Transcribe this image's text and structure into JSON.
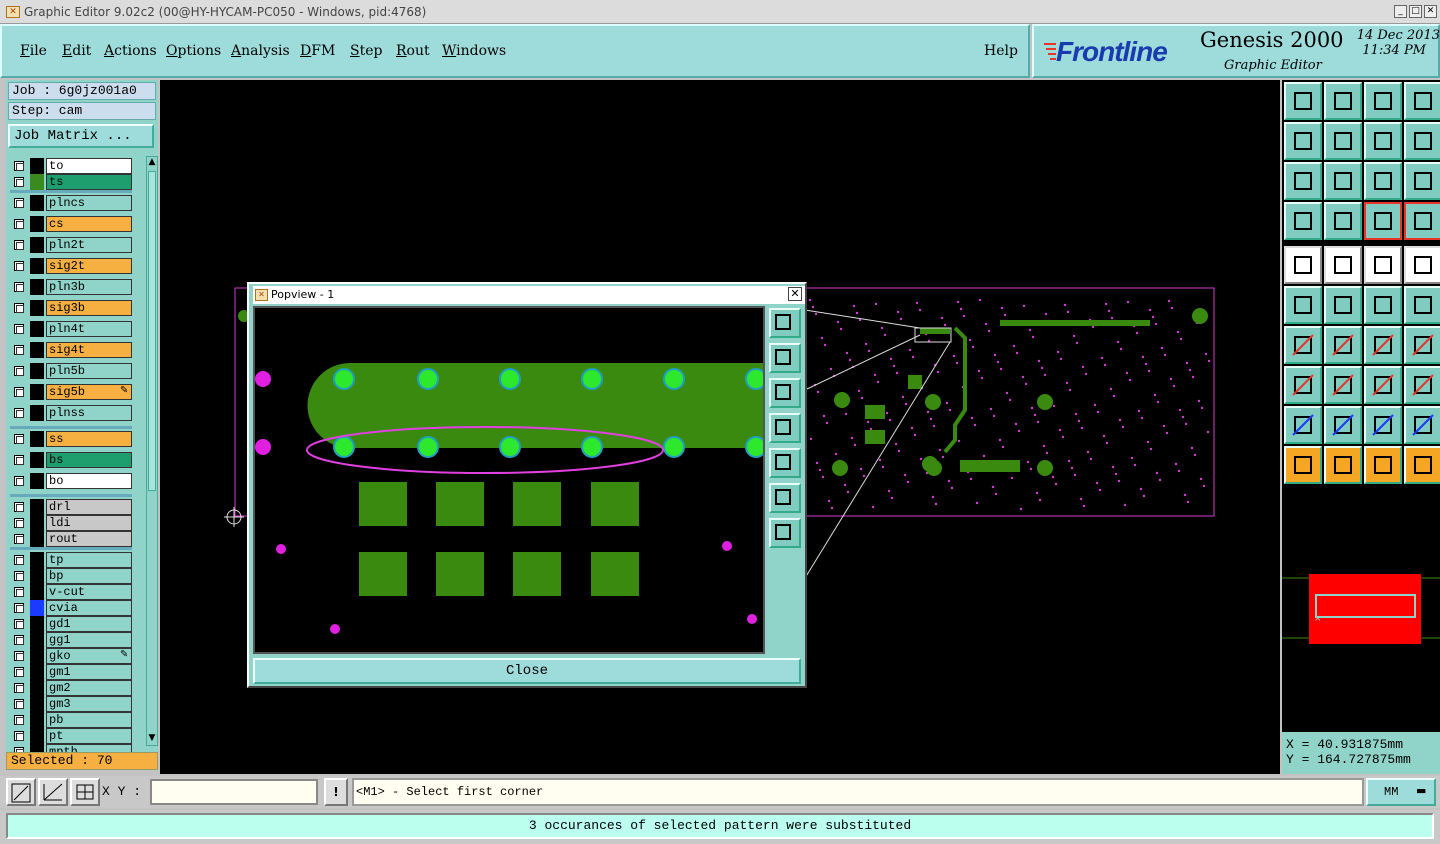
{
  "window": {
    "title": "Graphic Editor 9.02c2 (00@HY-HYCAM-PC050 - Windows, pid:4768)"
  },
  "menu": {
    "items": [
      "File",
      "Edit",
      "Actions",
      "Options",
      "Analysis",
      "DFM",
      "Step",
      "Rout",
      "Windows"
    ],
    "underline": [
      "F",
      "E",
      "A",
      "O",
      "A",
      "D",
      "S",
      "R",
      "W"
    ],
    "help": "Help"
  },
  "brand": {
    "logo": "Frontline",
    "product": "Genesis 2000",
    "subtitle": "Graphic Editor",
    "date": "14 Dec 2013",
    "time": "11:34 PM"
  },
  "job": {
    "job_line": "Job : 6g0jz001a0",
    "step_line": "Step: cam",
    "matrix_button": "Job Matrix ..."
  },
  "layers": [
    {
      "name": "to",
      "color": "#ffffff",
      "swatch": "#000000"
    },
    {
      "name": "ts",
      "color": "#1e9e6e",
      "swatch": "#3a8a20"
    },
    {
      "name": "plncs",
      "color": "#8fd3c9",
      "swatch": "#000000",
      "sepBefore": true
    },
    {
      "name": "cs",
      "color": "#f5b041",
      "swatch": "#000000"
    },
    {
      "name": "pln2t",
      "color": "#8fd3c9",
      "swatch": "#000000"
    },
    {
      "name": "sig2t",
      "color": "#f5b041",
      "swatch": "#000000"
    },
    {
      "name": "pln3b",
      "color": "#8fd3c9",
      "swatch": "#000000"
    },
    {
      "name": "sig3b",
      "color": "#f5b041",
      "swatch": "#000000"
    },
    {
      "name": "pln4t",
      "color": "#8fd3c9",
      "swatch": "#000000"
    },
    {
      "name": "sig4t",
      "color": "#f5b041",
      "swatch": "#000000"
    },
    {
      "name": "pln5b",
      "color": "#8fd3c9",
      "swatch": "#000000"
    },
    {
      "name": "sig5b",
      "color": "#f5b041",
      "swatch": "#000000",
      "mark": true
    },
    {
      "name": "plnss",
      "color": "#8fd3c9",
      "swatch": "#000000"
    },
    {
      "name": "ss",
      "color": "#f5b041",
      "swatch": "#000000",
      "sepBefore": true
    },
    {
      "name": "bs",
      "color": "#1e9e6e",
      "swatch": "#000000"
    },
    {
      "name": "bo",
      "color": "#ffffff",
      "swatch": "#000000"
    },
    {
      "name": "drl",
      "color": "#c8c8c8",
      "swatch": "#000000",
      "sepBefore": true
    },
    {
      "name": "ldi",
      "color": "#c8c8c8",
      "swatch": "#000000"
    },
    {
      "name": "rout",
      "color": "#c8c8c8",
      "swatch": "#000000"
    },
    {
      "name": "tp",
      "color": "#8fd3c9",
      "swatch": "#000000",
      "sepBefore": true
    },
    {
      "name": "bp",
      "color": "#8fd3c9",
      "swatch": "#000000"
    },
    {
      "name": "v-cut",
      "color": "#8fd3c9",
      "swatch": "#000000"
    },
    {
      "name": "cvia",
      "color": "#8fd3c9",
      "swatch": "#1a3bff"
    },
    {
      "name": "gd1",
      "color": "#8fd3c9",
      "swatch": "#000000"
    },
    {
      "name": "gg1",
      "color": "#8fd3c9",
      "swatch": "#000000"
    },
    {
      "name": "gko",
      "color": "#8fd3c9",
      "swatch": "#000000",
      "mark": true
    },
    {
      "name": "gm1",
      "color": "#8fd3c9",
      "swatch": "#000000"
    },
    {
      "name": "gm2",
      "color": "#8fd3c9",
      "swatch": "#000000"
    },
    {
      "name": "gm3",
      "color": "#8fd3c9",
      "swatch": "#000000"
    },
    {
      "name": "pb",
      "color": "#8fd3c9",
      "swatch": "#000000"
    },
    {
      "name": "pt",
      "color": "#8fd3c9",
      "swatch": "#000000"
    },
    {
      "name": "mpth",
      "color": "#8fd3c9",
      "swatch": "#000000"
    }
  ],
  "selected": "Selected : 70",
  "popup": {
    "title": "Popview - 1",
    "close_label": "Close"
  },
  "coords": {
    "x": "X = 40.931875mm",
    "y": "Y = 164.727875mm"
  },
  "cmd": {
    "xy_label": "X Y :",
    "xy_value": "",
    "prompt": "<M1> - Select first corner",
    "unit": "MM"
  },
  "status": "3 occurances of selected pattern were substituted",
  "colors": {
    "panel": "#8fd3c9",
    "copper": "#3a8a10",
    "pad": "#2ee82e",
    "outline": "#d43cd4",
    "accent_red": "#e8352a"
  }
}
